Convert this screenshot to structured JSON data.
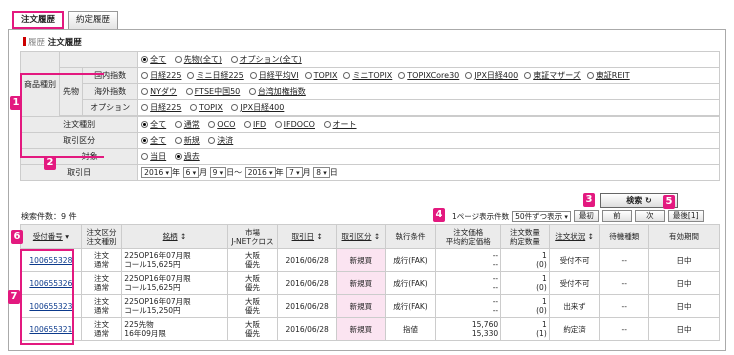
{
  "tabs": [
    "注文履歴",
    "約定履歴"
  ],
  "breadcrumb": {
    "parent": "履歴",
    "current": "注文履歴"
  },
  "filters": {
    "product_label": "商品種別",
    "sakimono_label": "先物",
    "row0": [
      "全て",
      "先物(全て)",
      "オプション(全て)"
    ],
    "domestic_label": "国内指数",
    "domestic": [
      "日経225",
      "ミニ日経225",
      "日経平均VI",
      "TOPIX",
      "ミニTOPIX",
      "TOPIXCore30",
      "JPX日経400",
      "東証マザーズ",
      "東証REIT"
    ],
    "overseas_label": "海外指数",
    "overseas": [
      "NYダウ",
      "FTSE中国50",
      "台湾加権指数"
    ],
    "option_label": "オプション",
    "options": [
      "日経225",
      "TOPIX",
      "JPX日経400"
    ],
    "order_type_label": "注文種別",
    "order_types": [
      "全て",
      "通常",
      "OCO",
      "IFD",
      "IFDOCO",
      "オート"
    ],
    "trade_label": "取引区分",
    "trade_types": [
      "全て",
      "新規",
      "決済"
    ],
    "target_label": "対象",
    "targets": [
      "当日",
      "過去"
    ],
    "date_label": "取引日",
    "from_year": "2016",
    "from_month": "6",
    "from_day": "9",
    "to_year": "2016",
    "to_month": "7",
    "to_day": "8",
    "u_year": "年",
    "u_month": "月",
    "u_day": "日",
    "tilde": "〜"
  },
  "search_label": "検索 ↻",
  "result_count": "検索件数：9 件",
  "pager": {
    "label": "1ページ表示件数",
    "select": "50件ずつ表示",
    "first": "最初",
    "prev": "前",
    "next": "次",
    "last": "最後[1]"
  },
  "headers": [
    "受付番号",
    "注文区分\n注文種別",
    "銘柄",
    "市場\nJ-NETクロス",
    "取引日",
    "取引区分",
    "執行条件",
    "注文価格\n平均約定価格",
    "注文数量\n約定数量",
    "注文状況",
    "待機種類",
    "有効期間"
  ],
  "rows": [
    {
      "id": "100655328",
      "kubun": "注文\n通常",
      "name": "225OP16年07月限\nコール15,625円",
      "market": "大阪\n優先",
      "date": "2016/06/28",
      "trade": "新規買",
      "cond": "成行(FAK)",
      "price": "--\n--",
      "qty": "1\n(0)",
      "status": "受付不可",
      "wait": "--",
      "valid": "日中"
    },
    {
      "id": "100655326",
      "kubun": "注文\n通常",
      "name": "225OP16年07月限\nコール15,625円",
      "market": "大阪\n優先",
      "date": "2016/06/28",
      "trade": "新規買",
      "cond": "成行(FAK)",
      "price": "--\n--",
      "qty": "1\n(0)",
      "status": "受付不可",
      "wait": "--",
      "valid": "日中"
    },
    {
      "id": "100655323",
      "kubun": "注文\n通常",
      "name": "225OP16年07月限\nコール15,250円",
      "market": "大阪\n優先",
      "date": "2016/06/28",
      "trade": "新規買",
      "cond": "成行(FAK)",
      "price": "--\n--",
      "qty": "1\n(0)",
      "status": "出来ず",
      "wait": "--",
      "valid": "日中"
    },
    {
      "id": "100655321",
      "kubun": "注文\n通常",
      "name": "225先物\n16年09月限",
      "market": "大阪\n優先",
      "date": "2016/06/28",
      "trade": "新規買",
      "cond": "指値",
      "price": "15,760\n15,330",
      "qty": "1\n(1)",
      "status": "約定済",
      "wait": "--",
      "valid": "日中"
    }
  ],
  "badges": [
    "1",
    "2",
    "3",
    "4",
    "5",
    "6",
    "7"
  ],
  "colors": {
    "accent": "#e3197f",
    "pink_cell": "#fbe4f1",
    "header_bg": "#ebebeb"
  }
}
